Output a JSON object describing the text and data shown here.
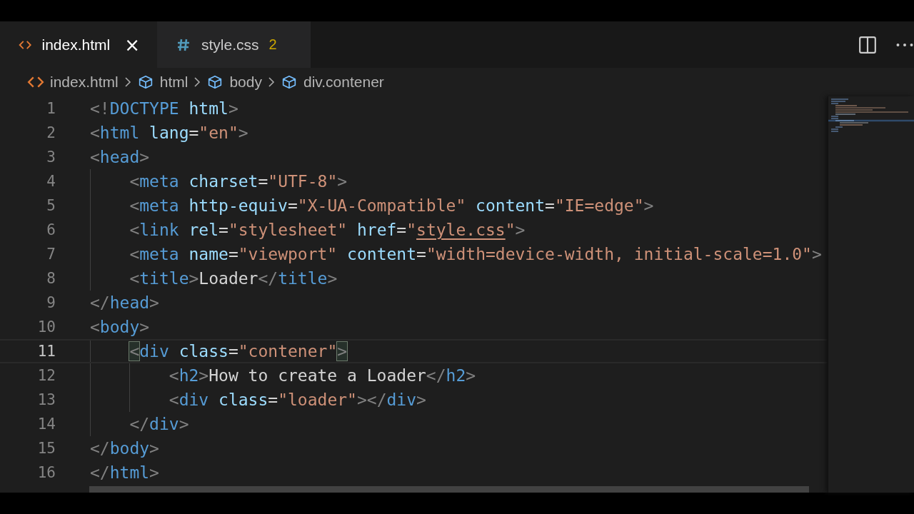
{
  "tabs": [
    {
      "kind": "html",
      "label": "index.html",
      "selected": true,
      "has_problems": false,
      "close": "×"
    },
    {
      "kind": "css",
      "label": "style.css",
      "selected": false,
      "has_problems": true,
      "problems": "2"
    }
  ],
  "breadcrumbs": [
    {
      "kind": "file",
      "label": "index.html"
    },
    {
      "kind": "element",
      "label": "html"
    },
    {
      "kind": "element",
      "label": "body"
    },
    {
      "kind": "element",
      "label": "div.contener"
    }
  ],
  "lines": [
    {
      "number": "1",
      "selected": false,
      "tokens": [
        {
          "kind": "punct",
          "text": "<!"
        },
        {
          "kind": "tag",
          "text": "DOCTYPE"
        },
        {
          "kind": "attr",
          "text": " html"
        },
        {
          "kind": "punct",
          "text": ">"
        }
      ]
    },
    {
      "number": "2",
      "selected": false,
      "tokens": [
        {
          "kind": "punct",
          "text": "<"
        },
        {
          "kind": "tag",
          "text": "html"
        },
        {
          "kind": "attr",
          "text": " lang"
        },
        {
          "kind": "plain",
          "text": "="
        },
        {
          "kind": "string",
          "text": "\"en\""
        },
        {
          "kind": "punct",
          "text": ">"
        }
      ]
    },
    {
      "number": "3",
      "selected": false,
      "tokens": [
        {
          "kind": "punct",
          "text": "<"
        },
        {
          "kind": "tag",
          "text": "head"
        },
        {
          "kind": "punct",
          "text": ">"
        }
      ]
    },
    {
      "number": "4",
      "selected": false,
      "tokens": [
        {
          "kind": "punct",
          "text": "    <"
        },
        {
          "kind": "tag",
          "text": "meta"
        },
        {
          "kind": "attr",
          "text": " charset"
        },
        {
          "kind": "plain",
          "text": "="
        },
        {
          "kind": "string",
          "text": "\"UTF-8\""
        },
        {
          "kind": "punct",
          "text": ">"
        }
      ]
    },
    {
      "number": "5",
      "selected": false,
      "tokens": [
        {
          "kind": "punct",
          "text": "    <"
        },
        {
          "kind": "tag",
          "text": "meta"
        },
        {
          "kind": "attr",
          "text": " http-equiv"
        },
        {
          "kind": "plain",
          "text": "="
        },
        {
          "kind": "string",
          "text": "\"X-UA-Compatible\""
        },
        {
          "kind": "attr",
          "text": " content"
        },
        {
          "kind": "plain",
          "text": "="
        },
        {
          "kind": "string",
          "text": "\"IE=edge\""
        },
        {
          "kind": "punct",
          "text": ">"
        }
      ]
    },
    {
      "number": "6",
      "selected": false,
      "tokens": [
        {
          "kind": "punct",
          "text": "    <"
        },
        {
          "kind": "tag",
          "text": "link"
        },
        {
          "kind": "attr",
          "text": " rel"
        },
        {
          "kind": "plain",
          "text": "="
        },
        {
          "kind": "string",
          "text": "\"stylesheet\""
        },
        {
          "kind": "attr",
          "text": " href"
        },
        {
          "kind": "plain",
          "text": "="
        },
        {
          "kind": "string",
          "text": "\""
        },
        {
          "kind": "link",
          "text": "style.css"
        },
        {
          "kind": "string",
          "text": "\""
        },
        {
          "kind": "punct",
          "text": ">"
        }
      ]
    },
    {
      "number": "7",
      "selected": false,
      "tokens": [
        {
          "kind": "punct",
          "text": "    <"
        },
        {
          "kind": "tag",
          "text": "meta"
        },
        {
          "kind": "attr",
          "text": " name"
        },
        {
          "kind": "plain",
          "text": "="
        },
        {
          "kind": "string",
          "text": "\"viewport\""
        },
        {
          "kind": "attr",
          "text": " content"
        },
        {
          "kind": "plain",
          "text": "="
        },
        {
          "kind": "string",
          "text": "\"width=device-width, initial-scale=1.0\""
        },
        {
          "kind": "punct",
          "text": ">"
        }
      ]
    },
    {
      "number": "8",
      "selected": false,
      "tokens": [
        {
          "kind": "punct",
          "text": "    <"
        },
        {
          "kind": "tag",
          "text": "title"
        },
        {
          "kind": "punct",
          "text": ">"
        },
        {
          "kind": "text",
          "text": "Loader"
        },
        {
          "kind": "punct",
          "text": "</"
        },
        {
          "kind": "tag",
          "text": "title"
        },
        {
          "kind": "punct",
          "text": ">"
        }
      ]
    },
    {
      "number": "9",
      "selected": false,
      "tokens": [
        {
          "kind": "punct",
          "text": "</"
        },
        {
          "kind": "tag",
          "text": "head"
        },
        {
          "kind": "punct",
          "text": ">"
        }
      ]
    },
    {
      "number": "10",
      "selected": false,
      "tokens": [
        {
          "kind": "punct",
          "text": "<"
        },
        {
          "kind": "tag",
          "text": "body"
        },
        {
          "kind": "punct",
          "text": ">"
        }
      ]
    },
    {
      "number": "11",
      "selected": true,
      "tokens": [
        {
          "kind": "bracket",
          "text": "    <"
        },
        {
          "kind": "tag",
          "text": "div"
        },
        {
          "kind": "attr",
          "text": " class"
        },
        {
          "kind": "plain",
          "text": "="
        },
        {
          "kind": "string",
          "text": "\"contener\""
        },
        {
          "kind": "bracket",
          "text": ">"
        }
      ]
    },
    {
      "number": "12",
      "selected": false,
      "tokens": [
        {
          "kind": "punct",
          "text": "        <"
        },
        {
          "kind": "tag",
          "text": "h2"
        },
        {
          "kind": "punct",
          "text": ">"
        },
        {
          "kind": "text",
          "text": "How to create a Loader"
        },
        {
          "kind": "punct",
          "text": "</"
        },
        {
          "kind": "tag",
          "text": "h2"
        },
        {
          "kind": "punct",
          "text": ">"
        }
      ]
    },
    {
      "number": "13",
      "selected": false,
      "tokens": [
        {
          "kind": "punct",
          "text": "        <"
        },
        {
          "kind": "tag",
          "text": "div"
        },
        {
          "kind": "attr",
          "text": " class"
        },
        {
          "kind": "plain",
          "text": "="
        },
        {
          "kind": "string",
          "text": "\"loader\""
        },
        {
          "kind": "punct",
          "text": "></"
        },
        {
          "kind": "tag",
          "text": "div"
        },
        {
          "kind": "punct",
          "text": ">"
        }
      ]
    },
    {
      "number": "14",
      "selected": false,
      "tokens": [
        {
          "kind": "punct",
          "text": "    </"
        },
        {
          "kind": "tag",
          "text": "div"
        },
        {
          "kind": "punct",
          "text": ">"
        }
      ]
    },
    {
      "number": "15",
      "selected": false,
      "tokens": [
        {
          "kind": "punct",
          "text": "</"
        },
        {
          "kind": "tag",
          "text": "body"
        },
        {
          "kind": "punct",
          "text": ">"
        }
      ]
    },
    {
      "number": "16",
      "selected": false,
      "tokens": [
        {
          "kind": "punct",
          "text": "</"
        },
        {
          "kind": "tag",
          "text": "html"
        },
        {
          "kind": "punct",
          "text": ">"
        }
      ]
    }
  ]
}
